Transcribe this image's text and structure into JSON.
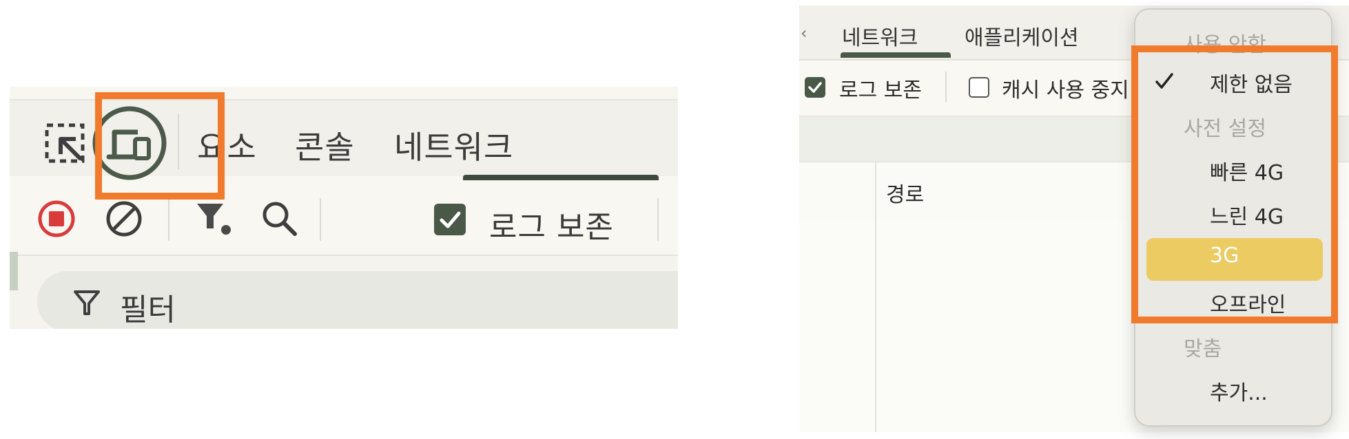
{
  "left": {
    "tabs": [
      "요소",
      "콘솔",
      "네트워크"
    ],
    "preserve_log_label": "로그 보존",
    "filter_label": "필터"
  },
  "right": {
    "tabs": [
      "네트워크",
      "애플리케이션"
    ],
    "preserve_log_label": "로그 보존",
    "disable_cache_label": "캐시 사용 중지",
    "column_header_path": "경로",
    "throttle_menu": {
      "header_disabled": "사용 안함",
      "no_throttle": "제한 없음",
      "presets_header": "사전 설정",
      "fast_4g": "빠른 4G",
      "slow_4g": "느린 4G",
      "three_g": "3G",
      "offline": "오프라인",
      "custom_header": "맞춤",
      "add": "추가..."
    }
  },
  "colors": {
    "highlight": "#f07b2c",
    "selected_item": "#eccb63",
    "record_red": "#d93b3b",
    "accent_dark_green": "#495847"
  }
}
